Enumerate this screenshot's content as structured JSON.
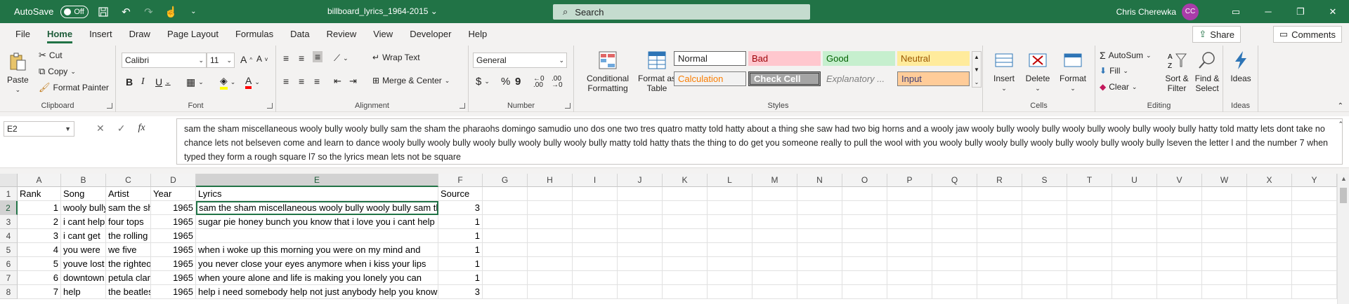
{
  "titlebar": {
    "autosave_label": "AutoSave",
    "autosave_state": "Off",
    "doc_title": "billboard_lyrics_1964-2015",
    "search_placeholder": "Search",
    "user_name": "Chris Cherewka",
    "user_initials": "CC"
  },
  "tabs": [
    "File",
    "Home",
    "Insert",
    "Draw",
    "Page Layout",
    "Formulas",
    "Data",
    "Review",
    "View",
    "Developer",
    "Help"
  ],
  "active_tab": "Home",
  "share_label": "Share",
  "comments_label": "Comments",
  "ribbon": {
    "clipboard": {
      "paste": "Paste",
      "cut": "Cut",
      "copy": "Copy",
      "format_painter": "Format Painter",
      "label": "Clipboard"
    },
    "font": {
      "name": "Calibri",
      "size": "11",
      "label": "Font"
    },
    "alignment": {
      "wrap_text": "Wrap Text",
      "merge_center": "Merge & Center",
      "label": "Alignment"
    },
    "number": {
      "format": "General",
      "label": "Number"
    },
    "styles": {
      "conditional": "Conditional Formatting",
      "format_table": "Format as Table",
      "cells": [
        "Normal",
        "Bad",
        "Good",
        "Neutral",
        "Calculation",
        "Check Cell",
        "Explanatory ...",
        "Input"
      ],
      "label": "Styles"
    },
    "cells": {
      "insert": "Insert",
      "delete": "Delete",
      "format": "Format",
      "label": "Cells"
    },
    "editing": {
      "autosum": "AutoSum",
      "fill": "Fill",
      "clear": "Clear",
      "sort_filter": "Sort & Filter",
      "find_select": "Find & Select",
      "label": "Editing"
    },
    "ideas": {
      "ideas": "Ideas",
      "label": "Ideas"
    }
  },
  "formula_bar": {
    "name_box": "E2",
    "content": "sam the sham miscellaneous wooly bully wooly bully sam the sham  the pharaohs  domingo samudio uno dos one two tres quatro matty told hatty about a thing she saw had two big horns and a wooly jaw wooly bully wooly bully wooly bully wooly bully wooly bully hatty told matty lets dont take no chance lets not belseven come and learn to dance wooly bully wooly bully wooly bully wooly bully wooly bully matty told hatty thats the thing to do get you someone really to pull the wool with you wooly bully wooly bully wooly bully wooly bully wooly bully lseven  the letter l and the number 7 when typed they form a rough square l7 so the lyrics mean lets not be square"
  },
  "grid": {
    "columns": [
      "A",
      "B",
      "C",
      "D",
      "E",
      "F",
      "G",
      "H",
      "I",
      "J",
      "K",
      "L",
      "M",
      "N",
      "O",
      "P",
      "Q",
      "R",
      "S",
      "T",
      "U",
      "V",
      "W",
      "X",
      "Y"
    ],
    "rows": [
      [
        "Rank",
        "Song",
        "Artist",
        "Year",
        "Lyrics",
        "Source"
      ],
      [
        "1",
        "wooly bully",
        "sam the sham",
        "1965",
        "sam the sham miscellaneous wooly bully wooly bully sam the sham",
        "3"
      ],
      [
        "2",
        "i cant help",
        "four tops",
        "1965",
        " sugar pie honey bunch you know that i love you i cant help",
        "1"
      ],
      [
        "3",
        "i cant get",
        "the rolling",
        "1965",
        "",
        "1"
      ],
      [
        "4",
        "you were",
        "we five",
        "1965",
        " when i woke up this morning you were on my mind and",
        "1"
      ],
      [
        "5",
        "youve lost",
        "the righteous",
        "1965",
        " you never close your eyes anymore when i kiss your lips",
        "1"
      ],
      [
        "6",
        "downtown",
        "petula clark",
        "1965",
        " when youre alone and life is making you lonely you can",
        "1"
      ],
      [
        "7",
        "help",
        "the beatles",
        "1965",
        "help i need somebody help not just anybody help you know",
        "3"
      ]
    ]
  }
}
